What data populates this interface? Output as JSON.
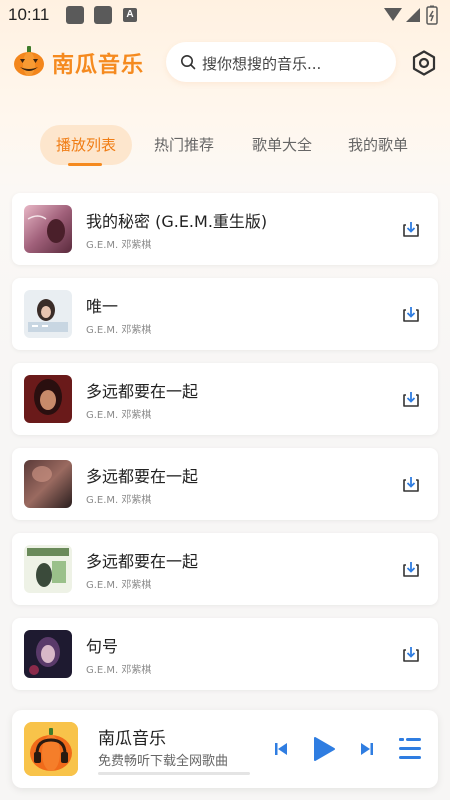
{
  "status_bar": {
    "time": "10:11",
    "badge_letter": "A"
  },
  "header": {
    "app_name": "南瓜音乐",
    "search_placeholder": "搜你想搜的音乐...",
    "logo_icon": "pumpkin-icon",
    "settings_icon": "hexagon-settings-icon"
  },
  "tabs": [
    {
      "label": "播放列表",
      "active": true
    },
    {
      "label": "热门推荐",
      "active": false
    },
    {
      "label": "歌单大全",
      "active": false
    },
    {
      "label": "我的歌单",
      "active": false
    }
  ],
  "songs": [
    {
      "title": "我的秘密 (G.E.M.重生版)",
      "artist": "G.E.M. 邓紫棋"
    },
    {
      "title": "唯一",
      "artist": "G.E.M. 邓紫棋"
    },
    {
      "title": "多远都要在一起",
      "artist": "G.E.M. 邓紫棋"
    },
    {
      "title": "多远都要在一起",
      "artist": "G.E.M. 邓紫棋"
    },
    {
      "title": "多远都要在一起",
      "artist": "G.E.M. 邓紫棋"
    },
    {
      "title": "句号",
      "artist": "G.E.M. 邓紫棋"
    }
  ],
  "player": {
    "title": "南瓜音乐",
    "subtitle": "免费畅听下载全网歌曲",
    "progress": 0.0
  },
  "colors": {
    "accent": "#f58a1f",
    "play_button": "#2f7de1",
    "tab_active_bg": "#fde6cd"
  }
}
